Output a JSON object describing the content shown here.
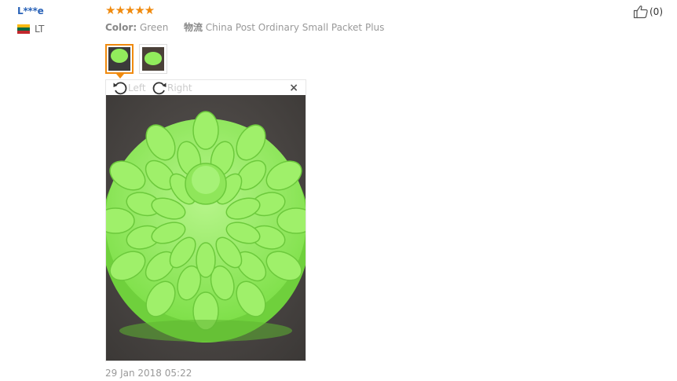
{
  "reviewer": {
    "name": "L***e",
    "country": "LT"
  },
  "review": {
    "stars": "★★★★★",
    "rating": 5,
    "color_key": "Color:",
    "color_value": "Green",
    "shipping_key": "物流",
    "shipping_value": "China Post Ordinary Small Packet Plus",
    "date": "29 Jan 2018 05:22"
  },
  "helpful": {
    "count": "(0)"
  },
  "viewer": {
    "rotate_left": "Left",
    "rotate_right": "Right",
    "close": "×"
  },
  "colors": {
    "accent": "#f08a0e",
    "link": "#2a63b8",
    "product": "#92ec5c"
  }
}
